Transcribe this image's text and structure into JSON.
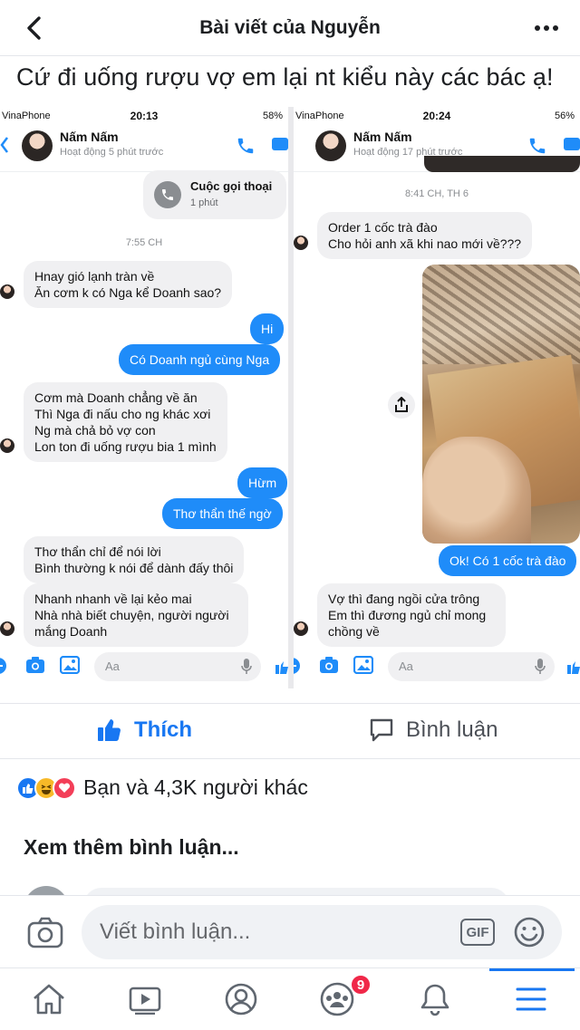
{
  "header": {
    "title": "Bài viết của Nguyễn"
  },
  "post": {
    "caption": "Cứ đi uống rượu vợ em lại nt kiểu này các bác ạ!"
  },
  "left_shot": {
    "carrier": "VinaPhone",
    "time": "20:13",
    "battery": "58%",
    "contact_name": "Nấm Nấm",
    "contact_active": "Hoạt động 5 phút trước",
    "call_card": {
      "title": "Cuộc gọi thoại",
      "duration": "1 phút"
    },
    "stamp": "7:55 CH",
    "messages": [
      {
        "dir": "in",
        "text": "Hnay gió lạnh tràn về\nĂn cơm k có Nga kể Doanh sao?"
      },
      {
        "dir": "out",
        "text": "Hi"
      },
      {
        "dir": "out",
        "text": "Có Doanh ngủ cùng Nga"
      },
      {
        "dir": "in",
        "text": "Cơm mà Doanh chẳng về ăn\nThì Nga đi nấu cho ng khác xơi\nNg mà chả bỏ vợ con\nLon ton đi uống rượu bia 1 mình"
      },
      {
        "dir": "out",
        "text": "Hừm"
      },
      {
        "dir": "out",
        "text": "Thơ thẩn thế ngờ"
      },
      {
        "dir": "in",
        "text": "Thơ thẩn chỉ để nói lời\nBình thường k nói để dành đấy thôi"
      },
      {
        "dir": "in",
        "text": "Nhanh nhanh về lại kẻo mai\nNhà nhà biết chuyện, người người mắng Doanh"
      }
    ],
    "composer_placeholder": "Aa"
  },
  "right_shot": {
    "carrier": "VinaPhone",
    "time": "20:24",
    "battery": "56%",
    "contact_name": "Nấm Nấm",
    "contact_active": "Hoạt động 17 phút trước",
    "stamp": "8:41 CH, TH 6",
    "messages": [
      {
        "dir": "in",
        "text": "Order 1 cốc trà đào\nCho hỏi anh xã khi nao mới về???"
      },
      {
        "dir": "out",
        "text": "Ok! Có 1 cốc trà đào"
      },
      {
        "dir": "in",
        "text": "Vợ thì đang ngồi cửa trông\nEm thì đương ngủ chỉ mong chồng về"
      }
    ],
    "composer_placeholder": "Aa"
  },
  "actions": {
    "like": "Thích",
    "comment": "Bình luận"
  },
  "reactions": {
    "summary": "Bạn và 4,3K người khác",
    "types": [
      "like-icon",
      "haha-icon",
      "love-icon"
    ]
  },
  "more_comments": "Xem thêm bình luận...",
  "comment_bar": {
    "placeholder": "Viết bình luận...",
    "gif": "GIF"
  },
  "bottom_nav": {
    "groups_badge": "9"
  },
  "colors": {
    "brand": "#1877f2",
    "bubble_out": "#1f8cf9",
    "bubble_in": "#f0f0f2",
    "badge": "#f02849"
  }
}
